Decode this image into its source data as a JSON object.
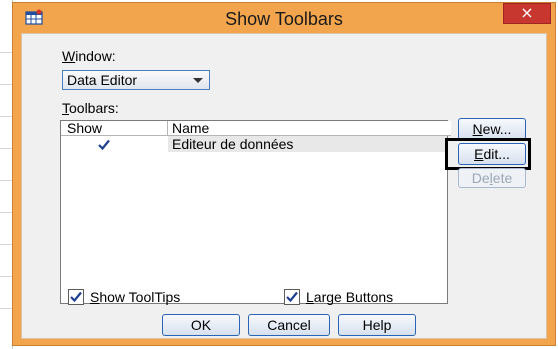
{
  "dialog": {
    "title": "Show Toolbars",
    "close_glyph": "×",
    "window_label": "Window:",
    "window_label_accel": "W",
    "window_label_rest": "indow:",
    "window_value": "Data Editor",
    "toolbars_label_accel": "T",
    "toolbars_label_rest": "oolbars:",
    "list": {
      "columns": [
        "Show",
        "Name"
      ],
      "rows": [
        {
          "show": true,
          "name": "Editeur de données"
        }
      ]
    },
    "buttons": {
      "new": {
        "accel": "N",
        "rest": "ew..."
      },
      "edit": {
        "accel": "E",
        "rest": "dit..."
      },
      "delete": {
        "pre": "De",
        "accel": "l",
        "rest": "ete"
      }
    },
    "options": {
      "show_tooltips": {
        "checked": true,
        "accel": "S",
        "rest": "how ToolTips"
      },
      "large_buttons": {
        "checked": true,
        "accel": "L",
        "rest": "arge Buttons"
      }
    },
    "footer": {
      "ok": "OK",
      "cancel": "Cancel",
      "help": "Help"
    }
  },
  "icons": {
    "app": "spss-app-icon",
    "close": "close-icon",
    "dropdown": "chevron-down-icon",
    "check": "checkmark-icon"
  },
  "colors": {
    "title_bar": "#f2a54c",
    "close_button": "#c7372f",
    "button_border": "#2b63b5",
    "client_bg": "#f0f0f0"
  }
}
